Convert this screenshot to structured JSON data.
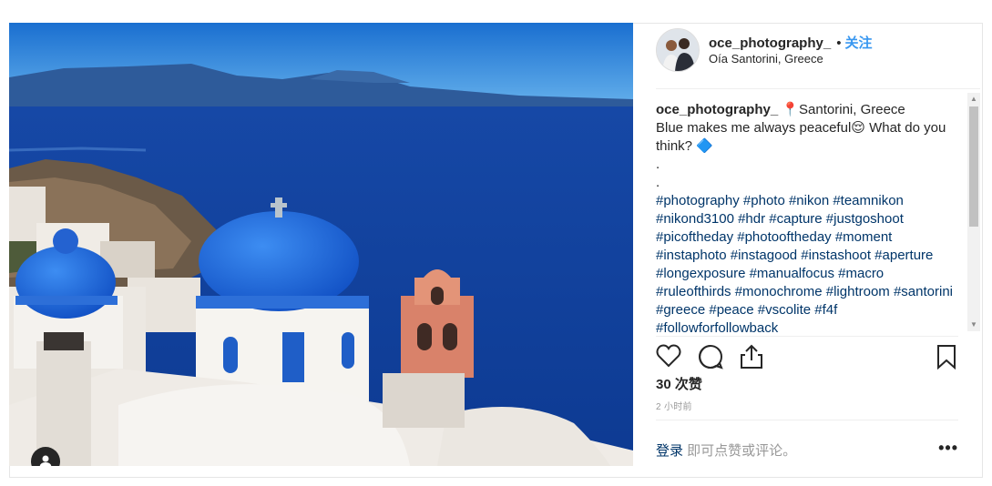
{
  "post": {
    "username": "oce_photography_",
    "separator": "•",
    "follow_label": "关注",
    "location": "Oía Santorini, Greece"
  },
  "caption": {
    "username": "oce_photography_",
    "pin_emoji": "📍",
    "line1": "Santorini, Greece",
    "line2": "Blue makes me always peaceful",
    "smile_emoji": "😌",
    "line2b": " What do you think? ",
    "diamond_emoji": "🔷",
    "dot1": ".",
    "dot2": ".",
    "hashtags": "#photography #photo #nikon #teamnikon #nikond3100 #hdr #capture #justgoshoot #picoftheday #photooftheday #moment #instaphoto #instagood #instashoot #aperture #longexposure #manualfocus #macro #ruleofthirds #monochrome #lightroom #santorini #greece #peace #vscolite #f4f #followforfollowback"
  },
  "stats": {
    "likes": "30 次赞",
    "time": "2 小时前"
  },
  "comment": {
    "login_link": "登录",
    "login_text": " 即可点赞或评论。",
    "more": "•••"
  },
  "icons": {
    "like": "heart-icon",
    "comment": "comment-icon",
    "share": "share-icon",
    "save": "bookmark-icon",
    "tagged": "user-tag-icon"
  }
}
